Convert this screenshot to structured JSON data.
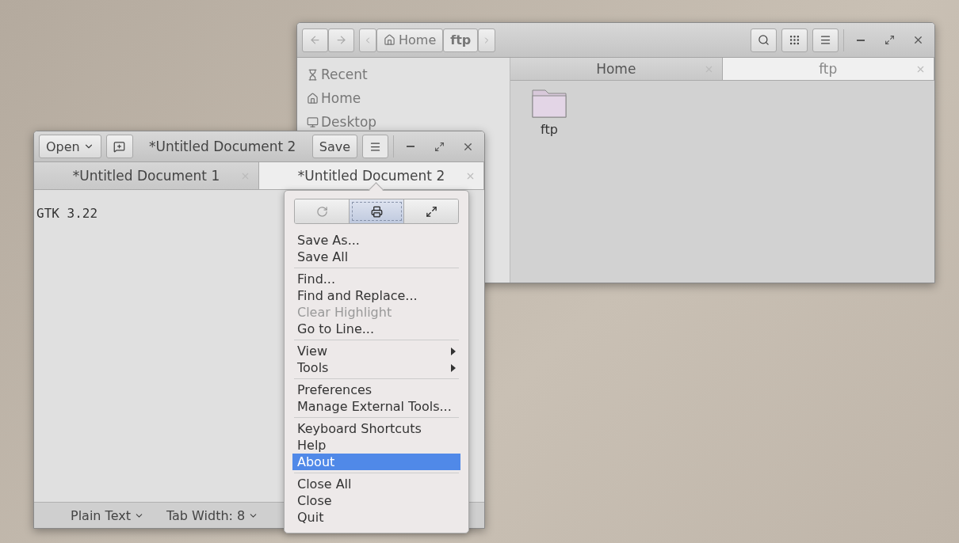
{
  "file_manager": {
    "nav_buttons": [
      {
        "kind": "back",
        "disabled": true
      },
      {
        "kind": "forward",
        "disabled": true
      }
    ],
    "path": [
      {
        "label": "Home",
        "kind": "home",
        "selected": false
      },
      {
        "label": "ftp",
        "kind": "folder",
        "selected": true
      }
    ],
    "tool_buttons": [
      {
        "kind": "search"
      },
      {
        "kind": "grid"
      },
      {
        "kind": "menu"
      }
    ],
    "sidebar": {
      "items": [
        {
          "label": "Recent",
          "kind": "recent"
        },
        {
          "label": "Home",
          "kind": "home"
        },
        {
          "label": "Desktop",
          "kind": "desktop"
        }
      ]
    },
    "tabs": [
      {
        "label": "Home",
        "selected": false
      },
      {
        "label": "ftp",
        "selected": true
      }
    ],
    "files": [
      {
        "name": "ftp"
      }
    ]
  },
  "editor": {
    "open_button": "Open",
    "title": "*Untitled Document 2",
    "save_button": "Save",
    "tabs": [
      {
        "label": "*Untitled Document 1",
        "selected": false
      },
      {
        "label": "*Untitled Document 2",
        "selected": true
      }
    ],
    "text": "GTK 3.22",
    "status_bar": [
      "Plain Text",
      "Tab Width: 8"
    ]
  },
  "menu": {
    "toolbar": [
      {
        "kind": "reload",
        "selected": false
      },
      {
        "kind": "print",
        "selected": true
      },
      {
        "kind": "fullscreen",
        "selected": false
      }
    ],
    "sections": [
      [
        {
          "label": "Save As...",
          "disabled": false,
          "submenu": false,
          "selected": false
        },
        {
          "label": "Save All",
          "disabled": false,
          "submenu": false,
          "selected": false
        }
      ],
      [
        {
          "label": "Find...",
          "disabled": false,
          "submenu": false,
          "selected": false
        },
        {
          "label": "Find and Replace...",
          "disabled": false,
          "submenu": false,
          "selected": false
        },
        {
          "label": "Clear Highlight",
          "disabled": true,
          "submenu": false,
          "selected": false
        },
        {
          "label": "Go to Line...",
          "disabled": false,
          "submenu": false,
          "selected": false
        }
      ],
      [
        {
          "label": "View",
          "disabled": false,
          "submenu": true,
          "selected": false
        },
        {
          "label": "Tools",
          "disabled": false,
          "submenu": true,
          "selected": false
        }
      ],
      [
        {
          "label": "Preferences",
          "disabled": false,
          "submenu": false,
          "selected": false
        },
        {
          "label": "Manage External Tools...",
          "disabled": false,
          "submenu": false,
          "selected": false
        }
      ],
      [
        {
          "label": "Keyboard Shortcuts",
          "disabled": false,
          "submenu": false,
          "selected": false
        },
        {
          "label": "Help",
          "disabled": false,
          "submenu": false,
          "selected": false
        },
        {
          "label": "About",
          "disabled": false,
          "submenu": false,
          "selected": true
        }
      ],
      [
        {
          "label": "Close All",
          "disabled": false,
          "submenu": false,
          "selected": false
        },
        {
          "label": "Close",
          "disabled": false,
          "submenu": false,
          "selected": false
        },
        {
          "label": "Quit",
          "disabled": false,
          "submenu": false,
          "selected": false
        }
      ]
    ]
  }
}
